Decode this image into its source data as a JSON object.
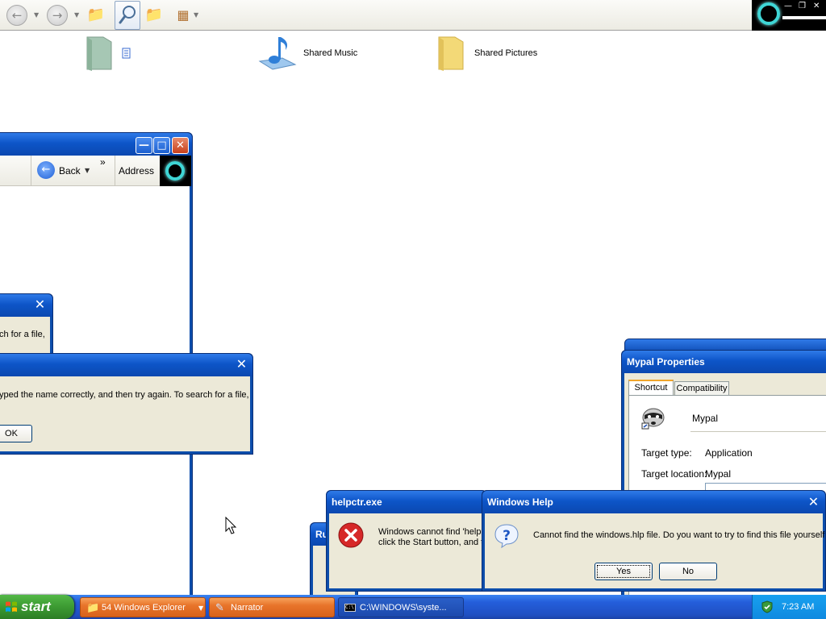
{
  "desktop": {
    "items": [
      {
        "label": "Shared Music",
        "icon": "music-folder-icon"
      },
      {
        "label": "Shared Pictures",
        "icon": "folder-icon"
      }
    ]
  },
  "explorer_window": {
    "back_label": "Back",
    "address_label": "Address",
    "chevron": "»"
  },
  "error_dialog_top": {
    "text_fragment": "ch for a file,"
  },
  "error_dialog_main": {
    "text_fragment": "yped the name correctly, and then try again. To search for a file,",
    "ok_label": "OK"
  },
  "mypal_properties": {
    "title": "Mypal Properties",
    "tabs": [
      "Shortcut",
      "Compatibility"
    ],
    "name": "Mypal",
    "target_type_label": "Target type:",
    "target_type_value": "Application",
    "target_location_label": "Target location:",
    "target_location_value": "Mypal"
  },
  "run_window": {
    "title_fragment": "Ru"
  },
  "helpctr_dialog": {
    "title": "helpctr.exe",
    "line1": "Windows cannot find 'helpc",
    "line2": "click the Start button, and t"
  },
  "windows_help_dialog": {
    "title": "Windows Help",
    "message": "Cannot find the windows.hlp file. Do you want to try to find this file yourself?",
    "yes_label": "Yes",
    "no_label": "No"
  },
  "taskbar": {
    "start_label": "start",
    "tasks": [
      {
        "label": "54 Windows Explorer",
        "icon": "folder-icon"
      },
      {
        "label": "Narrator",
        "icon": "narrator-icon"
      },
      {
        "label": "C:\\WINDOWS\\syste...",
        "icon": "console-icon"
      }
    ],
    "clock": "7:23 AM"
  },
  "colors": {
    "xp_blue": "#0c4dab",
    "start_green": "#3c9a32",
    "narrator_orange": "#e8742a"
  }
}
